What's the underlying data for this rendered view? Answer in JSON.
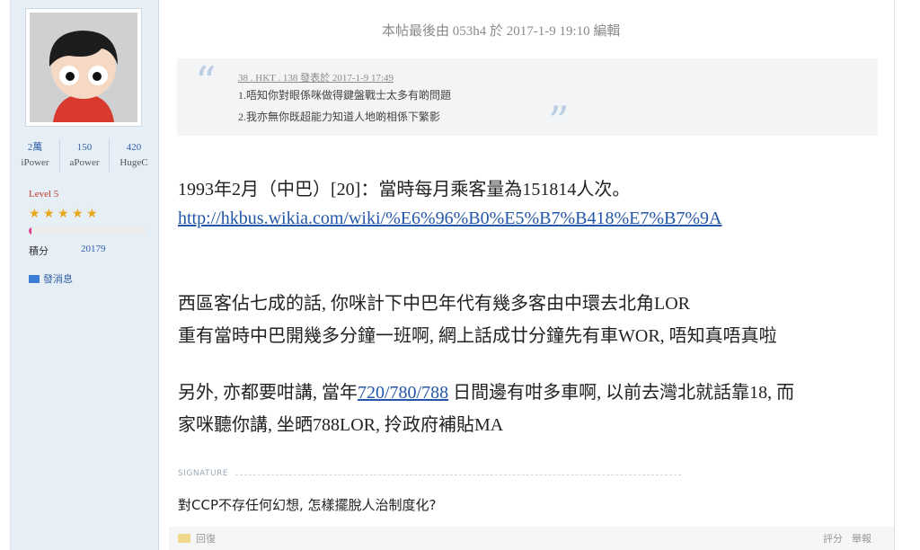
{
  "sidebar": {
    "stats": [
      {
        "value": "2萬",
        "label": "iPower"
      },
      {
        "value": "150",
        "label": "aPower"
      },
      {
        "value": "420",
        "label": "HugeC"
      }
    ],
    "level": "Level 5",
    "stars": 5,
    "progress_fraction": 0.02,
    "score_label": "積分",
    "score_value": "20179",
    "message_label": "發消息",
    "colors": {
      "level": "#c0392b",
      "progress": "#e0418f",
      "star": "#e8a817"
    }
  },
  "post": {
    "edit_note": "本帖最後由 053h4 於 2017-1-9 19:10 編輯",
    "quote": {
      "author": "38 . HKT . 138 發表於 2017-1-9 17:49",
      "line1": "1.唔知你對眼係咪做得鍵盤戰士太多有啲問題",
      "line2": "2.我亦無你既超能力知道人地啲相係下繁影"
    },
    "line1": "1993年2月（中巴）[20]：當時每月乘客量為151814人次。",
    "link": "http://hkbus.wikia.com/wiki/%E6%96%B0%E5%B7%B418%E7%B7%9A",
    "para2_line1": "西區客佔七成的話, 你咪計下中巴年代有幾多客由中環去北角LOR",
    "para2_line2": "重有當時中巴開幾多分鐘一班啊, 網上話成廿分鐘先有車WOR, 唔知真唔真啦",
    "para3_pre": "另外, 亦都要咁講, 當年",
    "para3_link": "720/780/788",
    "para3_post": " 日間邊有咁多車啊, 以前去灣北就話靠18, 而",
    "para3_line2": "家咪聽你講, 坐晒788LOR, 拎政府補貼MA"
  },
  "signature": {
    "label": "SIGNATURE",
    "text": "對CCP不存任何幻想, 怎樣擺脫人治制度化?"
  },
  "footer": {
    "reply": "回復",
    "rate": "評分",
    "report": "舉報"
  }
}
